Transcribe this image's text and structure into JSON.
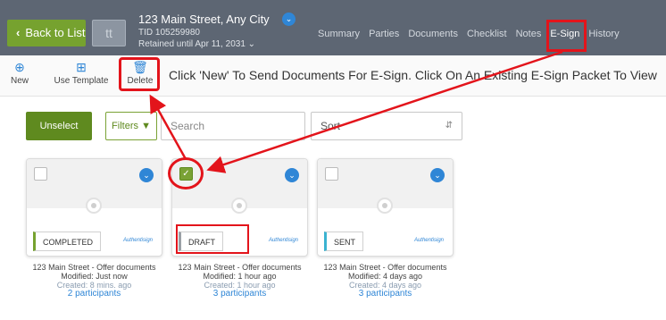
{
  "header": {
    "back_label": "Back to List",
    "logo_text": "tt",
    "address": "123 Main Street, Any City",
    "tid": "TID 105259980",
    "retained": "Retained until Apr 11, 2031 ⌄",
    "tabs": [
      "Summary",
      "Parties",
      "Documents",
      "Checklist",
      "Notes",
      "E-Sign",
      "History"
    ]
  },
  "toolbar": {
    "new_label": "New",
    "template_label": "Use Template",
    "delete_label": "Delete",
    "hint": "Click 'New' To Send Documents For E-Sign. Click On An Existing E-Sign Packet To View"
  },
  "filters": {
    "unselect_label": "Unselect",
    "filters_label": "Filters",
    "search_placeholder": "Search",
    "sort_value": "Sort"
  },
  "cards": [
    {
      "status": "COMPLETED",
      "brand": "Authentisign",
      "checked": false,
      "title": "123 Main Street - Offer documents",
      "modified": "Modified: Just now",
      "created": "Created: 8 mins. ago",
      "participants": "2 participants"
    },
    {
      "status": "DRAFT",
      "brand": "Authentisign",
      "checked": true,
      "title": "123 Main Street - Offer documents",
      "modified": "Modified: 1 hour ago",
      "created": "Created: 1 hour ago",
      "participants": "3 participants"
    },
    {
      "status": "SENT",
      "brand": "Authentisign",
      "checked": false,
      "title": "123 Main Street - Offer documents",
      "modified": "Modified: 4 days ago",
      "created": "Created: 4 days ago",
      "participants": "3 participants"
    }
  ],
  "icons": {
    "new": "plus-circle-icon",
    "template": "grid-icon",
    "delete": "trash-icon",
    "filter": "funnel-icon",
    "expand": "chevron-down-icon",
    "check": "checkmark-icon"
  },
  "colors": {
    "header_bg": "#5d6673",
    "accent_green": "#76a22f",
    "accent_blue": "#2f86d6",
    "annotation_red": "#e3141b"
  }
}
